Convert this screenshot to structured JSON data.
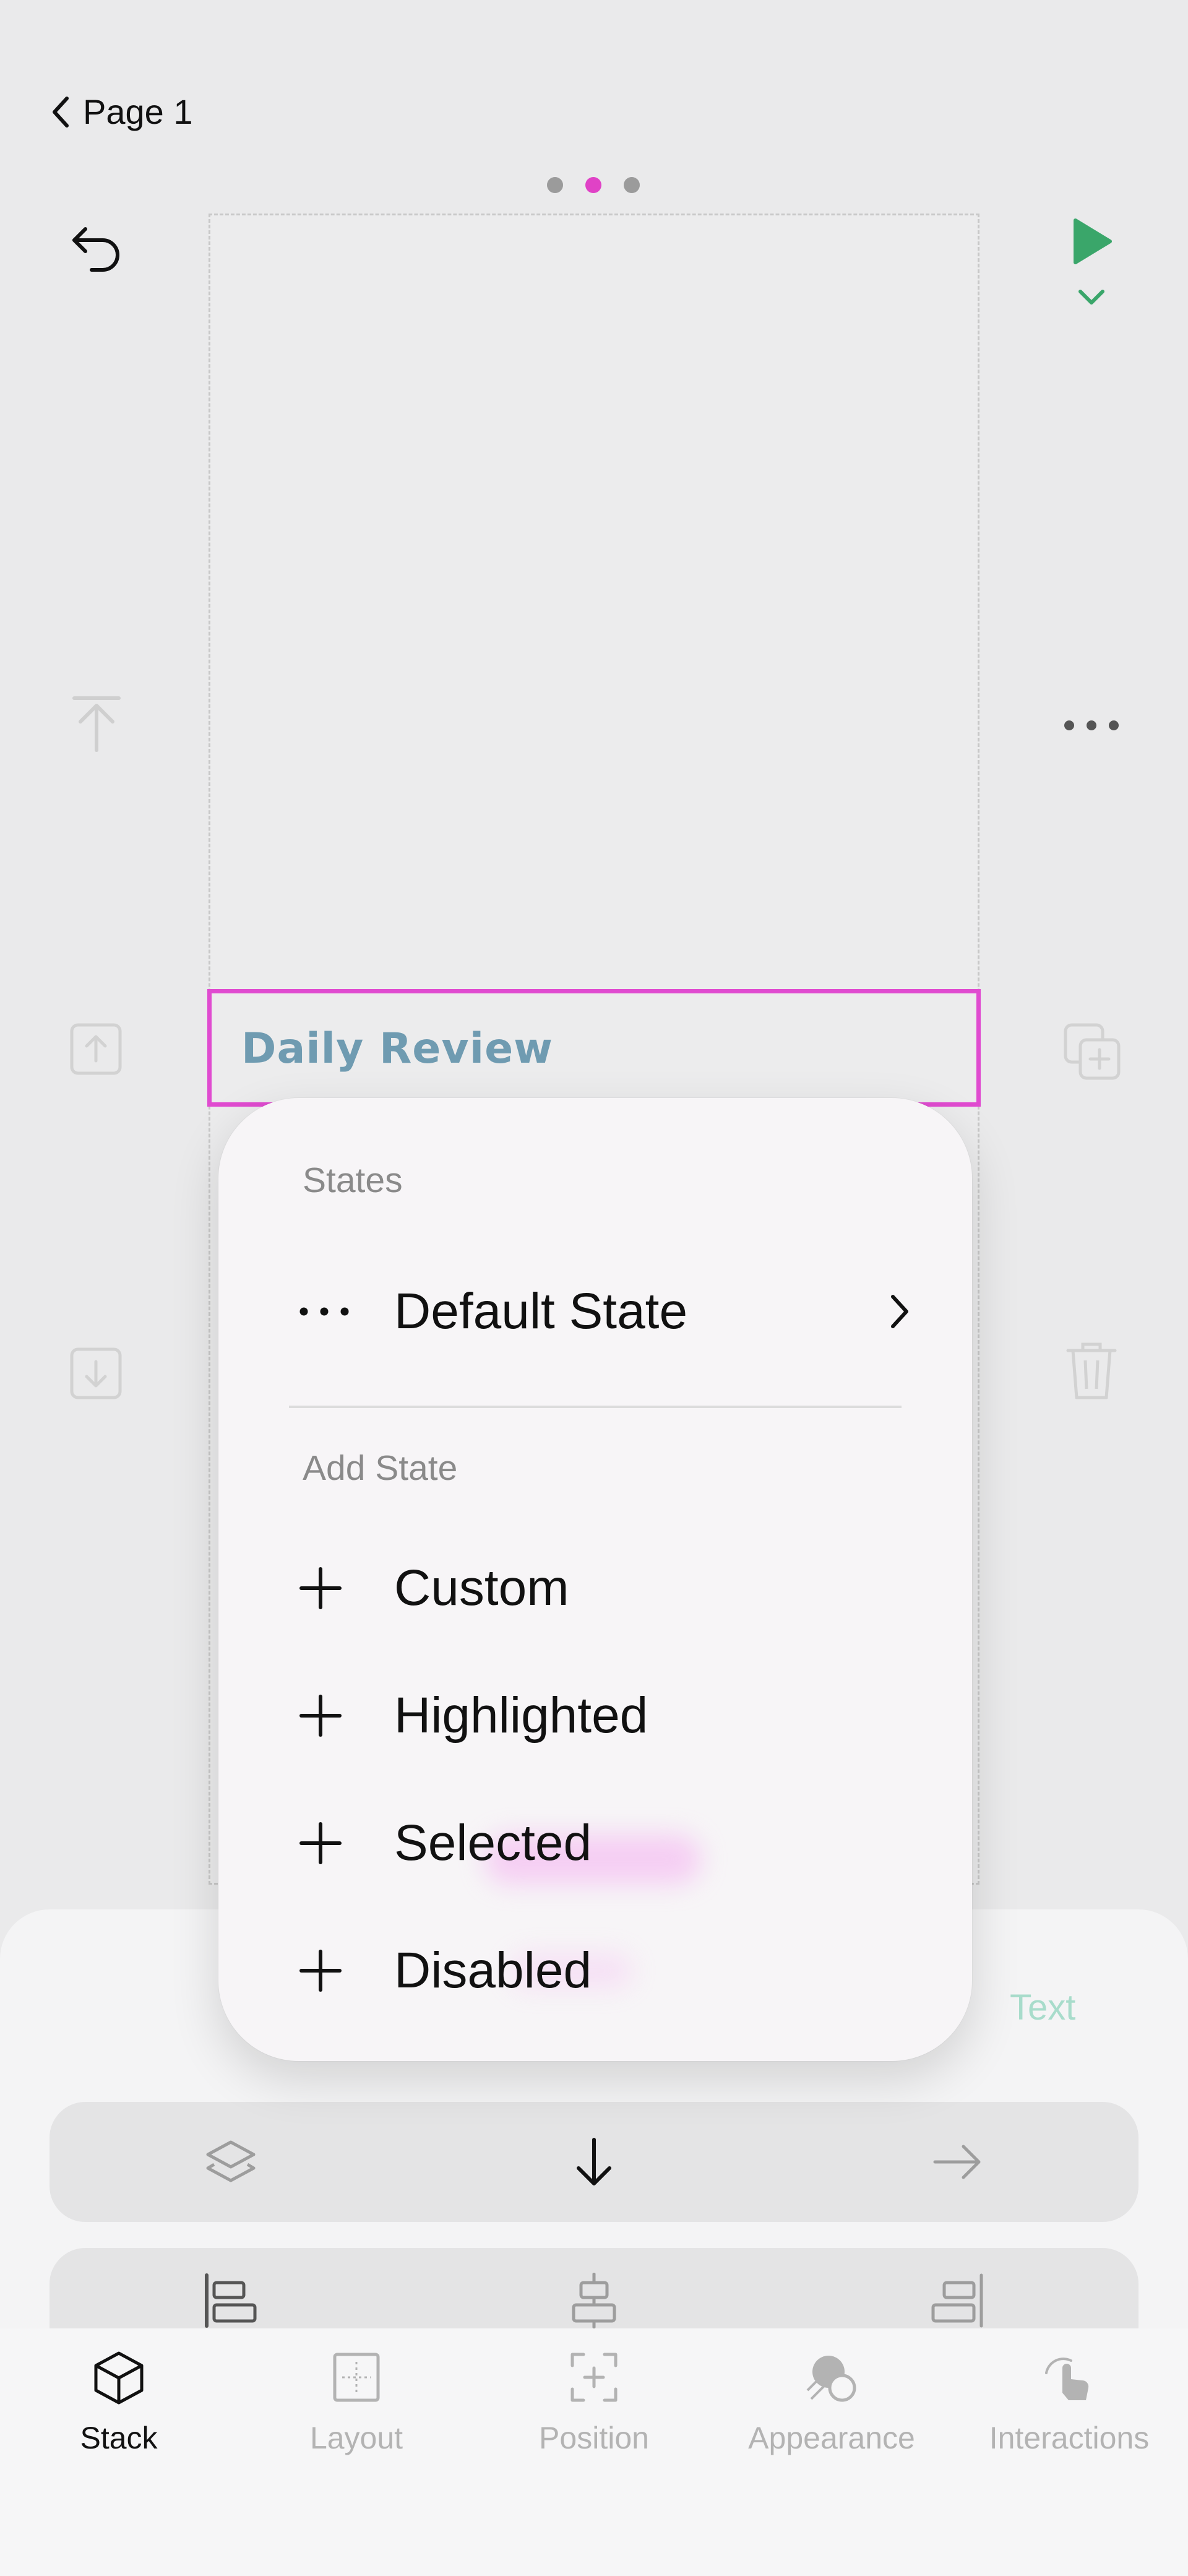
{
  "header": {
    "back_label": "Page 1",
    "page_indicator": {
      "total": 3,
      "active": 2
    }
  },
  "canvas": {
    "selected_text": "Daily Review",
    "selection_color": "#e04bd0",
    "selected_text_color": "#6f9bb1"
  },
  "toolbar_right": {
    "play_color": "#3aa66a"
  },
  "states_menu": {
    "states_label": "States",
    "default_state_label": "Default State",
    "add_state_label": "Add State",
    "add_options": [
      "Custom",
      "Highlighted",
      "Selected",
      "Disabled"
    ]
  },
  "panel": {
    "ghost_label": "Text"
  },
  "tabs": [
    {
      "label": "Stack",
      "icon": "cube-icon",
      "active": true
    },
    {
      "label": "Layout",
      "icon": "layout-grid-icon",
      "active": false
    },
    {
      "label": "Position",
      "icon": "position-icon",
      "active": false
    },
    {
      "label": "Appearance",
      "icon": "appearance-icon",
      "active": false
    },
    {
      "label": "Interactions",
      "icon": "tap-hand-icon",
      "active": false
    }
  ]
}
